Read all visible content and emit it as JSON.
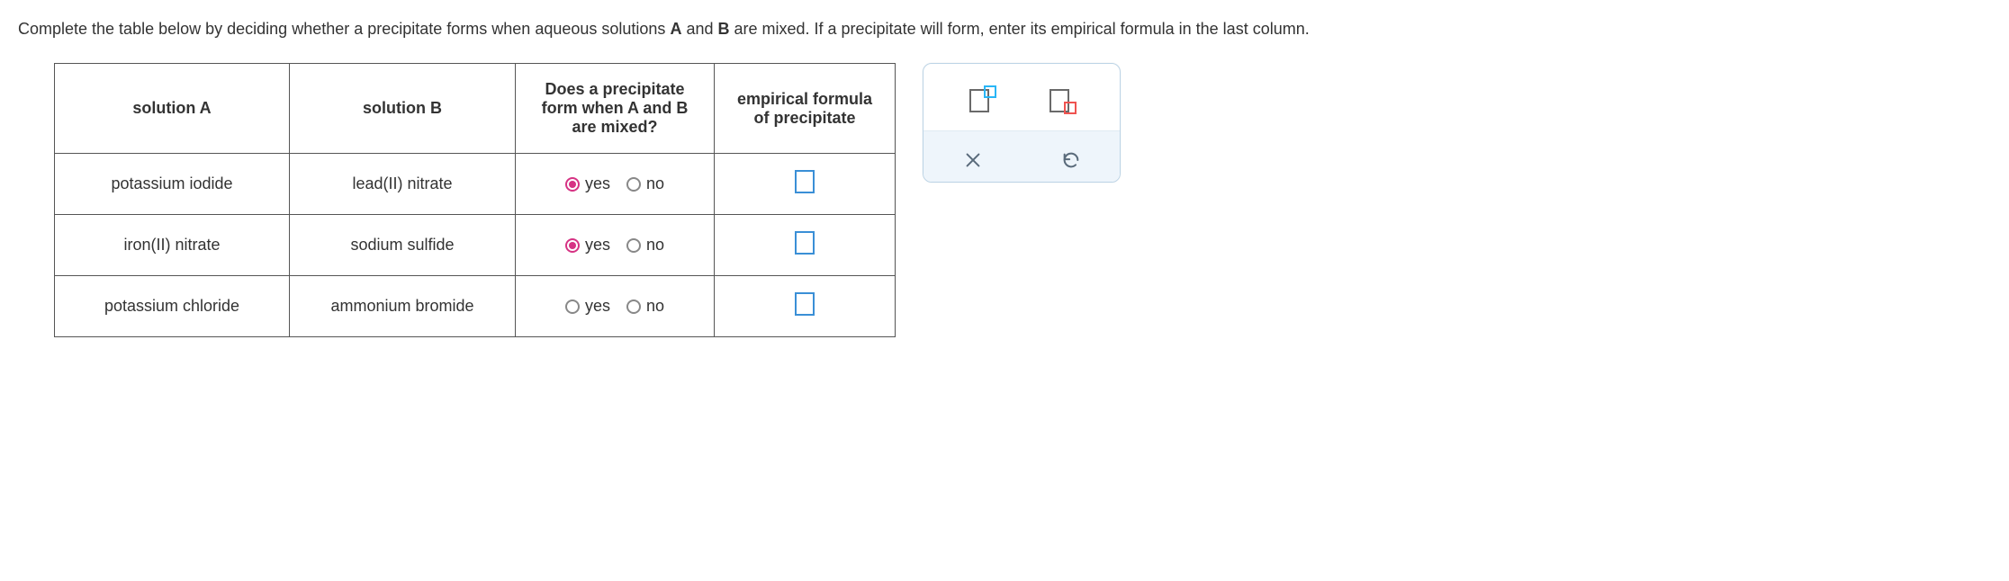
{
  "prompt_html_parts": {
    "p1": "Complete the table below by deciding whether a precipitate forms when aqueous solutions ",
    "b1": "A",
    "p2": " and ",
    "b2": "B",
    "p3": " are mixed. If a precipitate will form, enter its empirical formula in the last column."
  },
  "headers": {
    "solA": "solution A",
    "solB": "solution B",
    "precip_q": "Does a precipitate form when A and B are mixed?",
    "formula": "empirical formula of precipitate"
  },
  "radio_labels": {
    "yes": "yes",
    "no": "no"
  },
  "rows": [
    {
      "a": "potassium iodide",
      "b": "lead(II) nitrate",
      "yes_selected": true,
      "no_selected": false,
      "formula": ""
    },
    {
      "a": "iron(II) nitrate",
      "b": "sodium sulfide",
      "yes_selected": true,
      "no_selected": false,
      "formula": ""
    },
    {
      "a": "potassium chloride",
      "b": "ammonium bromide",
      "yes_selected": false,
      "no_selected": false,
      "formula": ""
    }
  ],
  "palette": {
    "superscript": "superscript-tool",
    "subscript": "subscript-tool",
    "clear": "clear",
    "reset": "reset"
  }
}
